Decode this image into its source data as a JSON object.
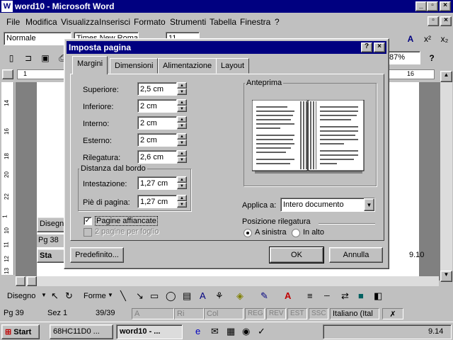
{
  "window": {
    "title": "word10 - Microsoft Word",
    "app_icon": "W"
  },
  "menu": [
    "File",
    "Modifica",
    "Visualizza",
    "Inserisci",
    "Formato",
    "Strumenti",
    "Tabella",
    "Finestra",
    "?"
  ],
  "toolbar": {
    "style_value": "Normale",
    "font_value": "Times New Roman",
    "size_value": "11",
    "zoom_value": "87%"
  },
  "dialog": {
    "title": "Imposta pagina",
    "tabs": [
      "Margini",
      "Dimensioni",
      "Alimentazione",
      "Layout"
    ],
    "fields": [
      {
        "label": "Superiore:",
        "value": "2,5 cm"
      },
      {
        "label": "Inferiore:",
        "value": "2 cm"
      },
      {
        "label": "Interno:",
        "value": "2 cm"
      },
      {
        "label": "Esterno:",
        "value": "2 cm"
      },
      {
        "label": "Rilegatura:",
        "value": "2,6 cm"
      }
    ],
    "distance_group": {
      "title": "Distanza dal bordo",
      "fields": [
        {
          "label": "Intestazione:",
          "value": "1,27 cm"
        },
        {
          "label": "Piè di pagina:",
          "value": "1,27 cm"
        }
      ]
    },
    "checkboxes": [
      {
        "label": "Pagine affiancate",
        "checked": true,
        "enabled": true
      },
      {
        "label": "2 pagine per foglio",
        "checked": false,
        "enabled": false
      }
    ],
    "preview_title": "Anteprima",
    "apply_label": "Applica a:",
    "apply_value": "Intero documento",
    "binding_title": "Posizione rilegatura",
    "binding_options": [
      {
        "label": "A sinistra",
        "selected": true
      },
      {
        "label": "In alto",
        "selected": false
      }
    ],
    "default_button": "Predefinito...",
    "ok_button": "OK",
    "cancel_button": "Annulla"
  },
  "behind": {
    "disegn_text": "Disegn",
    "pg_text": "Pg 38",
    "sta_text": "Sta",
    "time_inner": "9.10"
  },
  "drawing_toolbar": {
    "draw_label": "Disegno",
    "shapes_label": "Forme"
  },
  "status": {
    "page": "Pg 39",
    "section": "Sez 1",
    "pages": "39/39",
    "at": "A",
    "line": "Ri",
    "col": "Col",
    "rec": "REG",
    "rev": "REV",
    "ext": "EST",
    "ovr": "SSC",
    "lang": "Italiano (Ital"
  },
  "taskbar": {
    "start": "Start",
    "items": [
      "68HC11D0 ...",
      "word10 - ..."
    ],
    "clock": "9.14"
  },
  "ruler_numbers_h": [
    "1",
    "16"
  ],
  "ruler_numbers_v": [
    "14",
    "16",
    "18",
    "20",
    "22",
    "1",
    "10",
    "11",
    "12",
    "13"
  ]
}
